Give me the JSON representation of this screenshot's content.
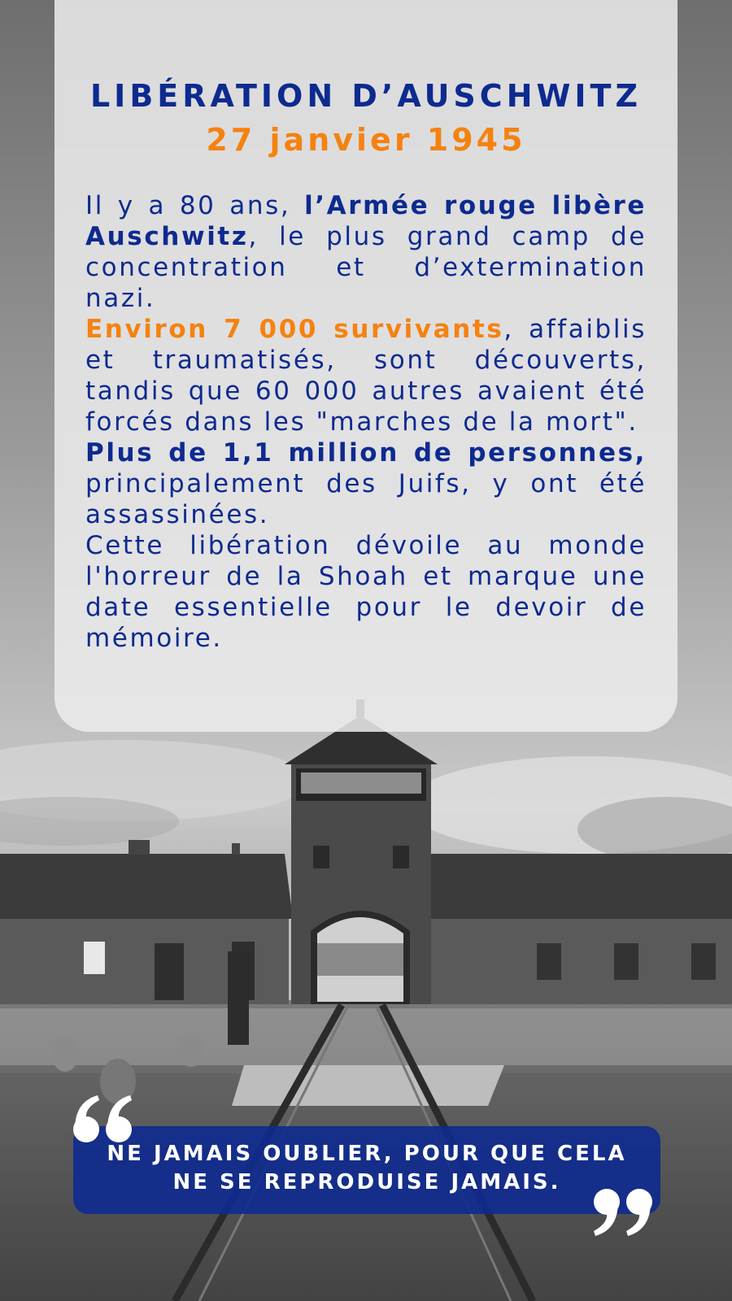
{
  "colors": {
    "navy": "#0d2a8f",
    "orange": "#f5820f",
    "card": "#ececee",
    "photo": "grayscale"
  },
  "header": {
    "title": "LIBÉRATION D’AUSCHWITZ",
    "date": "27 janvier 1945"
  },
  "paragraphs": {
    "p1": {
      "intro": "Il y a 80 ans, ",
      "highlight": "l’Armée rouge libère Auschwitz",
      "rest": ", le plus grand camp de concentration et d’extermination nazi."
    },
    "p2": {
      "highlight": "Environ 7 000 survivants",
      "rest": ", affaiblis et traumatisés, sont découverts, tandis que 60 000 autres avaient été forcés dans les \"marches de la mort\"."
    },
    "p3": {
      "highlight": "Plus de 1,1 million de personnes,",
      "rest": " principalement des Juifs, y ont été assassinées."
    },
    "p4": {
      "text": "Cette libération dévoile au monde l'horreur de la Shoah et marque une date essentielle pour le devoir de mémoire."
    }
  },
  "quote": {
    "line1": "NE JAMAIS OUBLIER, POUR QUE CELA",
    "line2": "NE SE REPRODUISE JAMAIS.",
    "open_icon": "quote-open-icon",
    "close_icon": "quote-close-icon"
  }
}
